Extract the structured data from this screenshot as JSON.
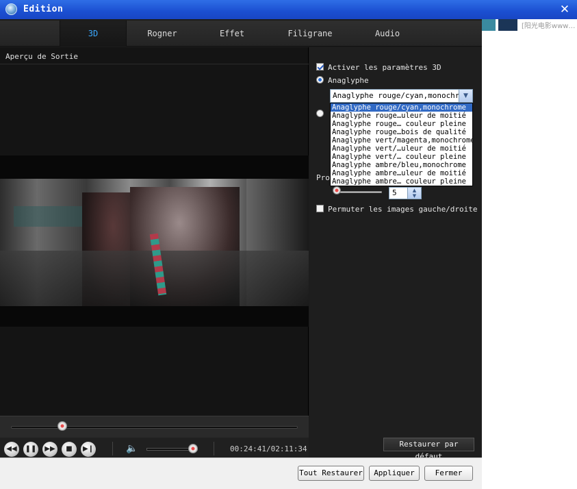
{
  "window": {
    "title": "Edition",
    "close_icon": "close-icon"
  },
  "background": {
    "text": "[阳光电影www…"
  },
  "tabs": [
    {
      "label": "3D",
      "active": true
    },
    {
      "label": "Rogner",
      "active": false
    },
    {
      "label": "Effet",
      "active": false
    },
    {
      "label": "Filigrane",
      "active": false
    },
    {
      "label": "Audio",
      "active": false
    }
  ],
  "preview": {
    "label": "Aperçu de Sortie",
    "seek_progress": 0.18,
    "volume_level": 0.9,
    "time": "00:24:41/02:11:34",
    "controls": [
      "rewind-icon",
      "pause-icon",
      "forward-icon",
      "stop-icon",
      "next-icon"
    ]
  },
  "settings": {
    "enable_3d_label": "Activer les paramètres 3D",
    "enable_3d_checked": true,
    "anaglyph_label": "Anaglyphe",
    "anaglyph_selected": true,
    "select_value": "Anaglyphe rouge/cyan,monochrome",
    "dropdown_options": [
      "Anaglyphe rouge/cyan,monochrome",
      "Anaglyphe rouge…uleur de moitié",
      "Anaglyphe rouge… couleur pleine",
      "Anaglyphe rouge…bois de qualité",
      "Anaglyphe vert/magenta,monochrome",
      "Anaglyphe vert/…uleur de moitié",
      "Anaglyphe vert/… couleur pleine",
      "Anaglyphe ambre/bleu,monochrome",
      "Anaglyphe ambre…uleur de moitié",
      "Anaglyphe ambre… couleur pleine"
    ],
    "dropdown_selected_index": 0,
    "depth_label": "Pro",
    "depth_value": "5",
    "swap_label": "Permuter les images gauche/droite",
    "swap_checked": false,
    "restore_default_label": "Restaurer par défaut"
  },
  "footer": {
    "restore_all_label": "Tout Restaurer",
    "apply_label": "Appliquer",
    "close_label": "Fermer"
  },
  "colors": {
    "accent": "#3aa8ff",
    "titlebar": "#1b4fd1",
    "selection": "#316ac5"
  }
}
